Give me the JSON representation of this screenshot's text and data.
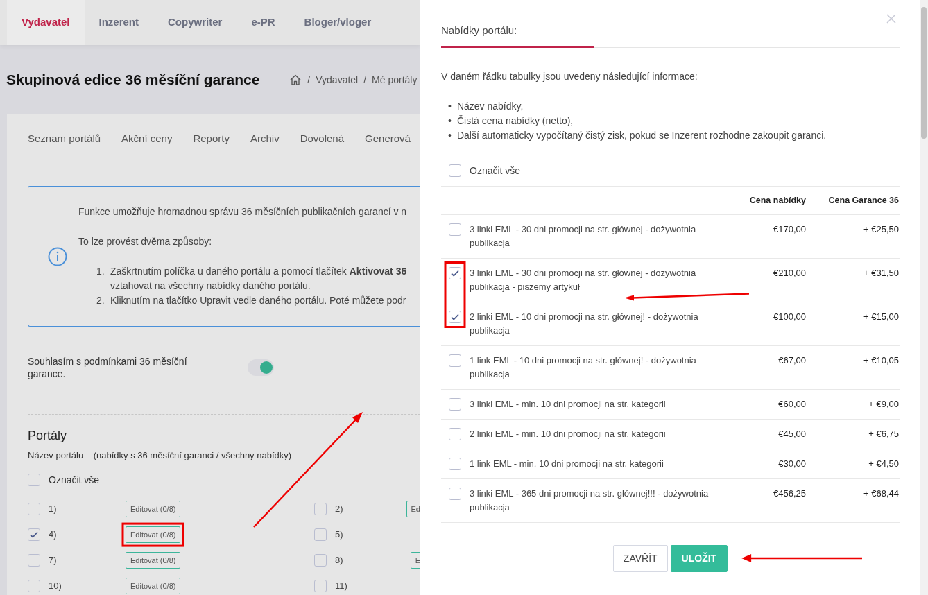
{
  "top_nav": [
    {
      "label": "Vydavatel",
      "selected": true
    },
    {
      "label": "Inzerent",
      "selected": false
    },
    {
      "label": "Copywriter",
      "selected": false
    },
    {
      "label": "e-PR",
      "selected": false
    },
    {
      "label": "Bloger/vloger",
      "selected": false
    }
  ],
  "page": {
    "title": "Skupinová edice 36 měsíční garance",
    "breadcrumb_separator": "/",
    "breadcrumb": [
      "Vydavatel",
      "Mé portály"
    ]
  },
  "subtabs": [
    "Seznam portálů",
    "Akční ceny",
    "Reporty",
    "Archiv",
    "Dovolená",
    "Generová"
  ],
  "info": {
    "paragraphs": [
      "Funkce umožňuje hromadnou správu 36 měsíčních publikačních garancí v n",
      "To lze provést dvěma způsoby:"
    ],
    "steps": [
      {
        "number": "1.",
        "lines": [
          "Zaškrtnutím políčka u daného portálu a pomocí tlačítek **Aktivovat 36**",
          "vztahovat na všechny nabídky daného portálu."
        ]
      },
      {
        "number": "2.",
        "lines": [
          "Kliknutím na tlačítko Upravit vedle daného portálu. Poté můžete podr"
        ]
      }
    ]
  },
  "agree": {
    "label": "Souhlasím s podmínkami 36 měsíční garance.",
    "on": true
  },
  "portals": {
    "title": "Portály",
    "subtitle": "Název portálu – (nabídky s 36 měsíční garanci / všechny nabídky)",
    "select_all": {
      "label": "Označit vše",
      "checked": false
    },
    "items": [
      {
        "label": "1)",
        "checked": false,
        "button": "Editovat (0/8)"
      },
      {
        "label": "2)",
        "checked": false,
        "button": "Ed"
      },
      {
        "label": "4)",
        "checked": true,
        "button": "Editovat (0/8)"
      },
      {
        "label": "5)",
        "checked": false
      },
      {
        "label": "7)",
        "checked": false,
        "button": "Editovat (0/8)"
      },
      {
        "label": "8)",
        "checked": false,
        "button": "E"
      },
      {
        "label": "10)",
        "checked": false,
        "button": "Editovat (0/8)"
      },
      {
        "label": "11)",
        "checked": false
      }
    ]
  },
  "modal": {
    "title": "Nabídky portálu:",
    "intro": "V daném řádku tabulky jsou uvedeny následující informace:",
    "bullet_marker": "•",
    "bullets": [
      "Název nabídky,",
      "Čistá cena nabídky (netto),",
      "Další automaticky vypočítaný čistý zisk, pokud se Inzerent rozhodne zakoupit garanci."
    ],
    "select_all": {
      "label": "Označit vše",
      "checked": false
    },
    "columns": [
      "Cena nabídky",
      "Cena Garance 36"
    ],
    "offers": [
      {
        "name": "3 linki EML - 30 dni promocji na str. głównej - dożywotnia publikacja",
        "price": "€170,00",
        "guarantee": "+ €25,50",
        "checked": false
      },
      {
        "name": "3 linki EML - 30 dni promocji na str. głównej - dożywotnia publikacja - piszemy artykuł",
        "price": "€210,00",
        "guarantee": "+ €31,50",
        "checked": true
      },
      {
        "name": "2 linki EML - 10 dni promocji na str. głównej! - dożywotnia publikacja",
        "price": "€100,00",
        "guarantee": "+ €15,00",
        "checked": true
      },
      {
        "name": "1 link EML - 10 dni promocji na str. głównej! - dożywotnia publikacja",
        "price": "€67,00",
        "guarantee": "+ €10,05",
        "checked": false
      },
      {
        "name": "3 linki EML - min. 10 dni promocji na str. kategorii",
        "price": "€60,00",
        "guarantee": "+ €9,00",
        "checked": false
      },
      {
        "name": "2 linki EML - min. 10 dni promocji na str. kategorii",
        "price": "€45,00",
        "guarantee": "+ €6,75",
        "checked": false
      },
      {
        "name": "1 link EML - min. 10 dni promocji na str. kategorii",
        "price": "€30,00",
        "guarantee": "+ €4,50",
        "checked": false
      },
      {
        "name": "3 linki EML - 365 dni promocji na str. głównej!!! - dożywotnia publikacja",
        "price": "€456,25",
        "guarantee": "+ €68,44",
        "checked": false
      }
    ],
    "buttons": [
      {
        "label": "ZAVŘÍT",
        "kind": "secondary"
      },
      {
        "label": "ULOŽIT",
        "kind": "primary"
      }
    ]
  }
}
